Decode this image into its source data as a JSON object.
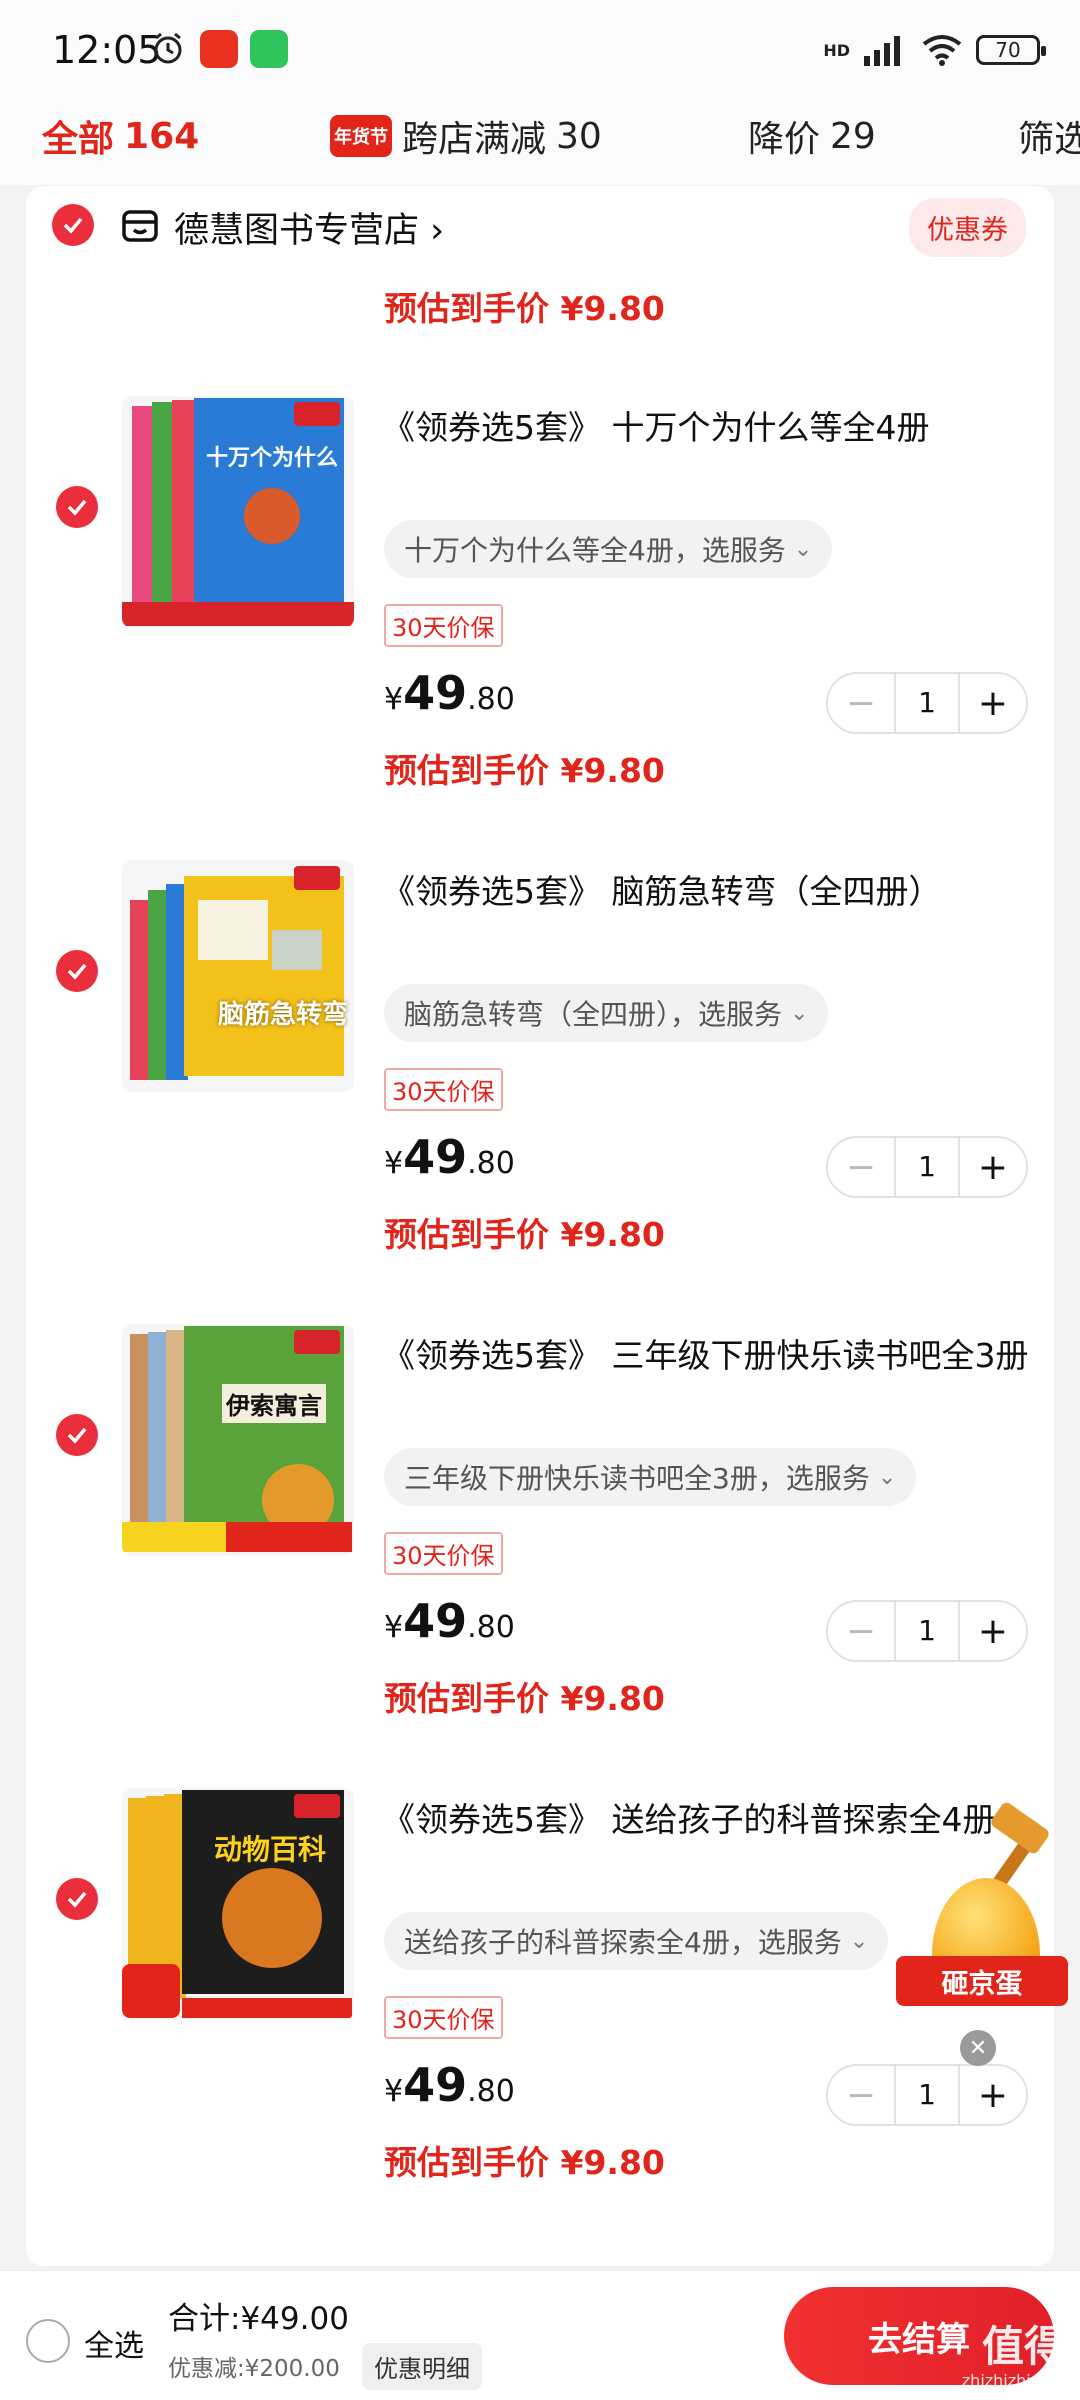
{
  "status_bar": {
    "time": "12:05",
    "network": "HD",
    "battery": "70"
  },
  "tabs": [
    {
      "label": "全部",
      "count": "164"
    },
    {
      "badge": "年货节",
      "label": "跨店满减",
      "count": "30"
    },
    {
      "label": "降价",
      "count": "29"
    },
    {
      "label": "筛选"
    }
  ],
  "shop": {
    "name": "德慧图书专营店 ›",
    "coupon_label": "优惠券",
    "prev_estimate": "预估到手价 ¥9.80"
  },
  "items": [
    {
      "title": "《领券选5套》 十万个为什么等全4册",
      "spec": "十万个为什么等全4册，选服务",
      "guarantee": "30天价保",
      "price_yen": "¥",
      "price_int": "49",
      "price_dec": ".80",
      "estimate": "预估到手价 ¥9.80",
      "qty": "1",
      "thumb_text": "十万个为什么",
      "thumb_color": "#2a7bd6"
    },
    {
      "title": "《领券选5套》 脑筋急转弯（全四册）",
      "spec": "脑筋急转弯（全四册），选服务",
      "guarantee": "30天价保",
      "price_yen": "¥",
      "price_int": "49",
      "price_dec": ".80",
      "estimate": "预估到手价 ¥9.80",
      "qty": "1",
      "thumb_text": "脑筋急转弯",
      "thumb_color": "#f3c21a"
    },
    {
      "title": "《领券选5套》 三年级下册快乐读书吧全3册",
      "spec": "三年级下册快乐读书吧全3册，选服务",
      "guarantee": "30天价保",
      "price_yen": "¥",
      "price_int": "49",
      "price_dec": ".80",
      "estimate": "预估到手价 ¥9.80",
      "qty": "1",
      "thumb_text": "伊索寓言",
      "thumb_color": "#5aa33a"
    },
    {
      "title": "《领券选5套》 送给孩子的科普探索全4册",
      "spec": "送给孩子的科普探索全4册，选服务",
      "guarantee": "30天价保",
      "price_yen": "¥",
      "price_int": "49",
      "price_dec": ".80",
      "estimate": "预估到手价 ¥9.80",
      "qty": "1",
      "thumb_text": "动物百科",
      "thumb_color": "#f0b41c"
    }
  ],
  "stepper": {
    "minus": "−",
    "plus": "+"
  },
  "floating_egg": {
    "label": "砸京蛋",
    "close": "✕"
  },
  "bottom": {
    "select_all": "全选",
    "total": "合计:¥49.00",
    "discount": "优惠减:¥200.00",
    "detail": "优惠明细",
    "checkout": "去结算",
    "watermark": "值得值",
    "watermark_sub": "zhizhizhi.com"
  },
  "colors": {
    "accent": "#e1251b",
    "check": "#ea2e3b"
  }
}
